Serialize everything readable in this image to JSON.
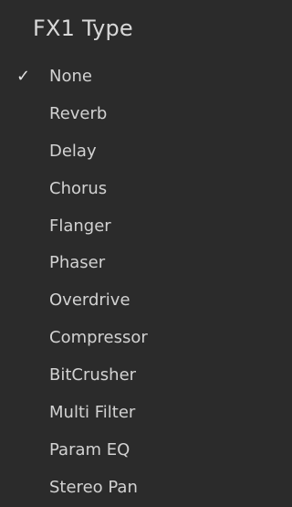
{
  "menu": {
    "title": "FX1 Type",
    "check_glyph": "✓",
    "selected_index": 0,
    "items": [
      {
        "label": "None",
        "selected": true
      },
      {
        "label": "Reverb",
        "selected": false
      },
      {
        "label": "Delay",
        "selected": false
      },
      {
        "label": "Chorus",
        "selected": false
      },
      {
        "label": "Flanger",
        "selected": false
      },
      {
        "label": "Phaser",
        "selected": false
      },
      {
        "label": "Overdrive",
        "selected": false
      },
      {
        "label": "Compressor",
        "selected": false
      },
      {
        "label": "BitCrusher",
        "selected": false
      },
      {
        "label": "Multi Filter",
        "selected": false
      },
      {
        "label": "Param EQ",
        "selected": false
      },
      {
        "label": "Stereo Pan",
        "selected": false
      }
    ]
  },
  "colors": {
    "background": "#2b2b2b",
    "text": "#d2d2d2",
    "title": "#d8d8d8"
  }
}
